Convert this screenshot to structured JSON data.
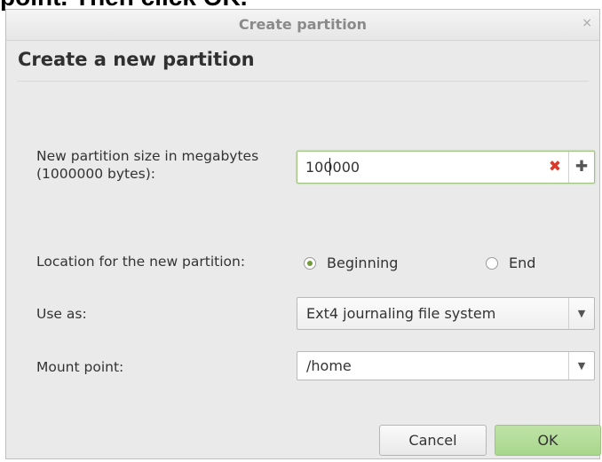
{
  "caption_fragment": "point. Then click OK.",
  "window": {
    "title": "Create partition",
    "close_icon": "close-icon"
  },
  "heading": "Create a new partition",
  "size": {
    "label": "New partition size in megabytes (1000000 bytes):",
    "value": "100000",
    "clear_icon": "clear-icon",
    "add_icon": "add-icon"
  },
  "location": {
    "label": "Location for the new partition:",
    "options": [
      "Beginning",
      "End"
    ],
    "selected": "Beginning"
  },
  "use_as": {
    "label": "Use as:",
    "value": "Ext4 journaling file system"
  },
  "mount": {
    "label": "Mount point:",
    "value": "/home"
  },
  "buttons": {
    "cancel": "Cancel",
    "ok": "OK"
  },
  "colors": {
    "ok_button": "#a9d68d",
    "radio_selected": "#6f9c39",
    "clear_icon": "#d93a2a"
  }
}
